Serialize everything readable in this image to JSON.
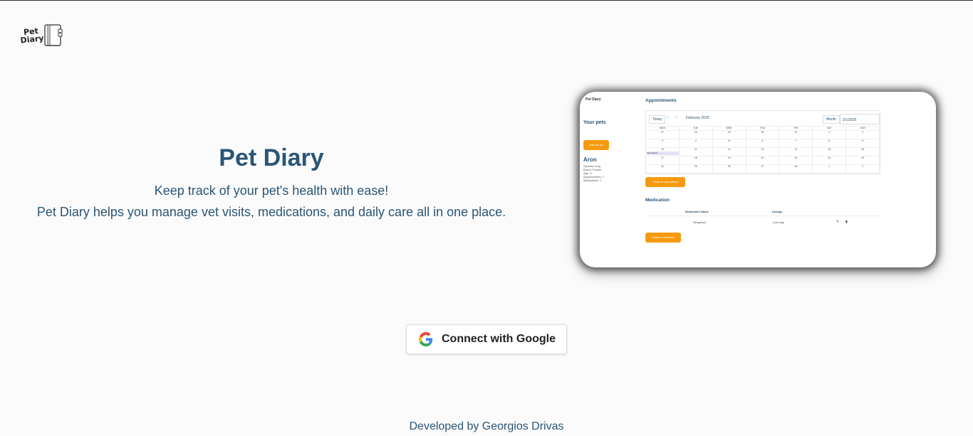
{
  "logo": {
    "text_line1": "Pet",
    "text_line2": "Diary"
  },
  "hero": {
    "title": "Pet Diary",
    "subtitle": "Keep track of your pet's health with ease!",
    "description": "Pet Diary helps you manage vet visits, medications, and daily care all in one place."
  },
  "preview": {
    "logo": "Pet Diary",
    "your_pets": "Your pets",
    "add_pet": "Add new pet",
    "pet_name": "Aron",
    "pet_info": [
      "Species: Dog",
      "Breed: Poodle",
      "Age: 3",
      "Appointments: 1",
      "Medications: 1"
    ],
    "appointments_title": "Appointments",
    "today_btn": "Today",
    "month_label": "February 2025",
    "view_btn": "Month",
    "date_value": "2/1/2025",
    "weekdays": [
      "MON",
      "TUE",
      "WED",
      "THU",
      "FRI",
      "SAT",
      "SUN"
    ],
    "days": [
      "27",
      "28",
      "29",
      "30",
      "31",
      "1",
      "2",
      "3",
      "4",
      "5",
      "6",
      "7",
      "8",
      "9",
      "10",
      "11",
      "12",
      "13",
      "14",
      "15",
      "16",
      "17",
      "18",
      "19",
      "20",
      "21",
      "22",
      "23",
      "24",
      "25",
      "26",
      "27",
      "28",
      "1",
      "2"
    ],
    "event": "Vaccination",
    "create_appointment": "Create an appointment",
    "medication_title": "Medication",
    "med_col1": "Medication Name",
    "med_col2": "Dosage",
    "med_name": "Simparica",
    "med_dosage": "1 per day",
    "create_med": "Create a medication"
  },
  "google_button": {
    "label": "Connect with Google"
  },
  "footer": {
    "text": "Developed by Georgios Drivas"
  }
}
